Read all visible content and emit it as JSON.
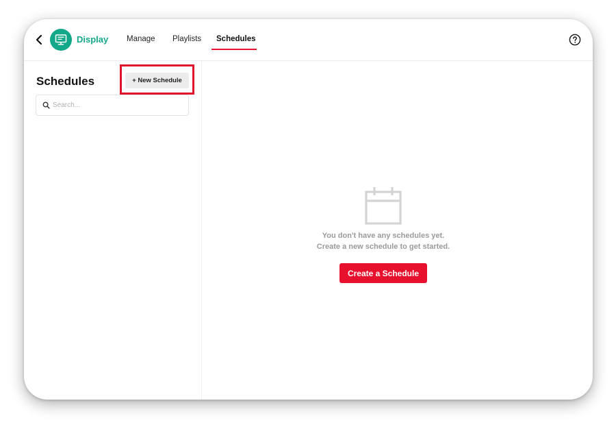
{
  "header": {
    "app_name": "Display",
    "tabs": [
      {
        "label": "Manage",
        "active": false
      },
      {
        "label": "Playlists",
        "active": false
      },
      {
        "label": "Schedules",
        "active": true
      }
    ]
  },
  "sidebar": {
    "title": "Schedules",
    "new_button_label": "+ New Schedule",
    "search_placeholder": "Search..."
  },
  "main": {
    "empty_line1": "You don't have any schedules yet.",
    "empty_line2": "Create a new schedule to get started.",
    "create_button_label": "Create a Schedule"
  },
  "colors": {
    "brand": "#13a88a",
    "accent": "#e8112d",
    "highlight": "#e0112b"
  },
  "icons": {
    "back": "chevron-left-icon",
    "app": "monitor-icon",
    "help": "help-icon",
    "search": "search-icon",
    "empty_state": "calendar-icon"
  }
}
